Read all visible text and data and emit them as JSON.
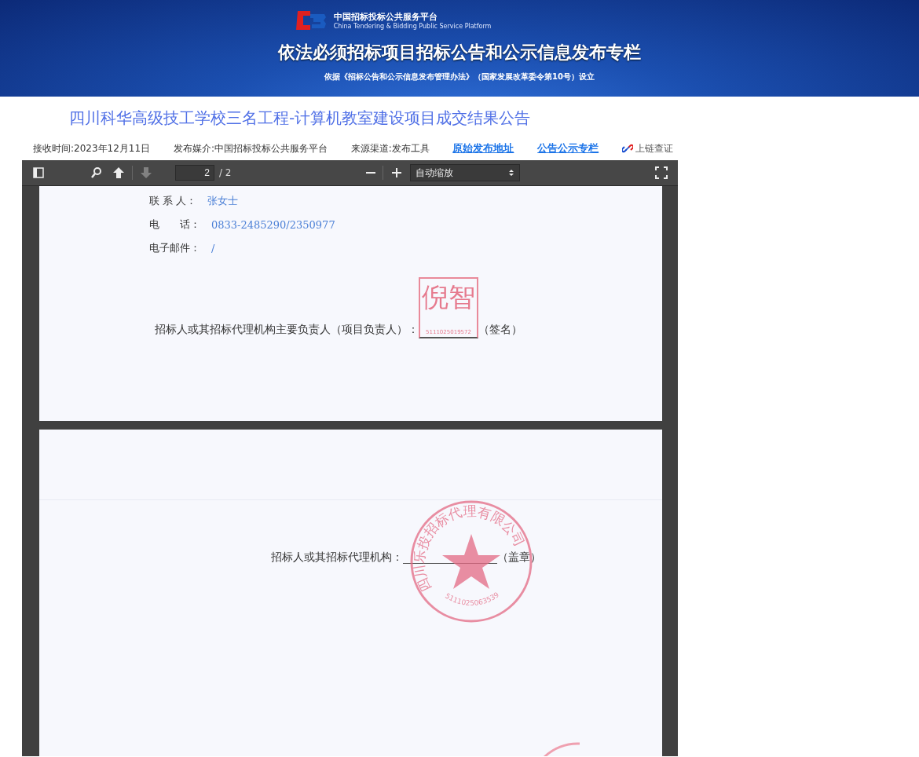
{
  "banner": {
    "logo_title": "中国招标投标公共服务平台",
    "logo_subtitle": "China Tendering & Bidding Public Service Platform",
    "heading": "依法必须招标项目招标公告和公示信息发布专栏",
    "basis": "依据《招标公告和公示信息发布管理办法》（国家发展改革委令第10号）设立"
  },
  "title": "四川科华高级技工学校三名工程-计算机教室建设项目成交结果公告",
  "meta": [
    {
      "kind": "text",
      "text": "接收时间:2023年12月11日"
    },
    {
      "kind": "text",
      "text": "发布媒介:中国招标投标公共服务平台"
    },
    {
      "kind": "text",
      "text": "来源渠道:发布工具"
    },
    {
      "kind": "link",
      "text": "原始发布地址"
    },
    {
      "kind": "link",
      "text": "公告公示专栏"
    },
    {
      "kind": "verify",
      "text": "上链查证"
    }
  ],
  "pdf_toolbar": {
    "prev_disabled": false,
    "next_disabled": true,
    "page_number": "2",
    "page_total": "/ 2",
    "zoom": "自动缩放"
  },
  "pages": [
    {
      "contacts": [
        {
          "label": "联 系 人：",
          "value": "张女士"
        },
        {
          "label": "电　　话：",
          "value": "0833-2485290/2350977"
        },
        {
          "label": "电子邮件：",
          "value": "/"
        }
      ],
      "statement": "招标人或其招标代理机构主要负责人（项目负责人）：",
      "stamp": {
        "name": "倪智",
        "number": "5111025019572"
      },
      "suffix": "（签名）"
    },
    {
      "statement": "招标人或其招标代理机构：",
      "seal": {
        "text": "四川乐投招标代理有限公司",
        "number": "5111025063539"
      },
      "suffix": "（盖章）"
    }
  ]
}
